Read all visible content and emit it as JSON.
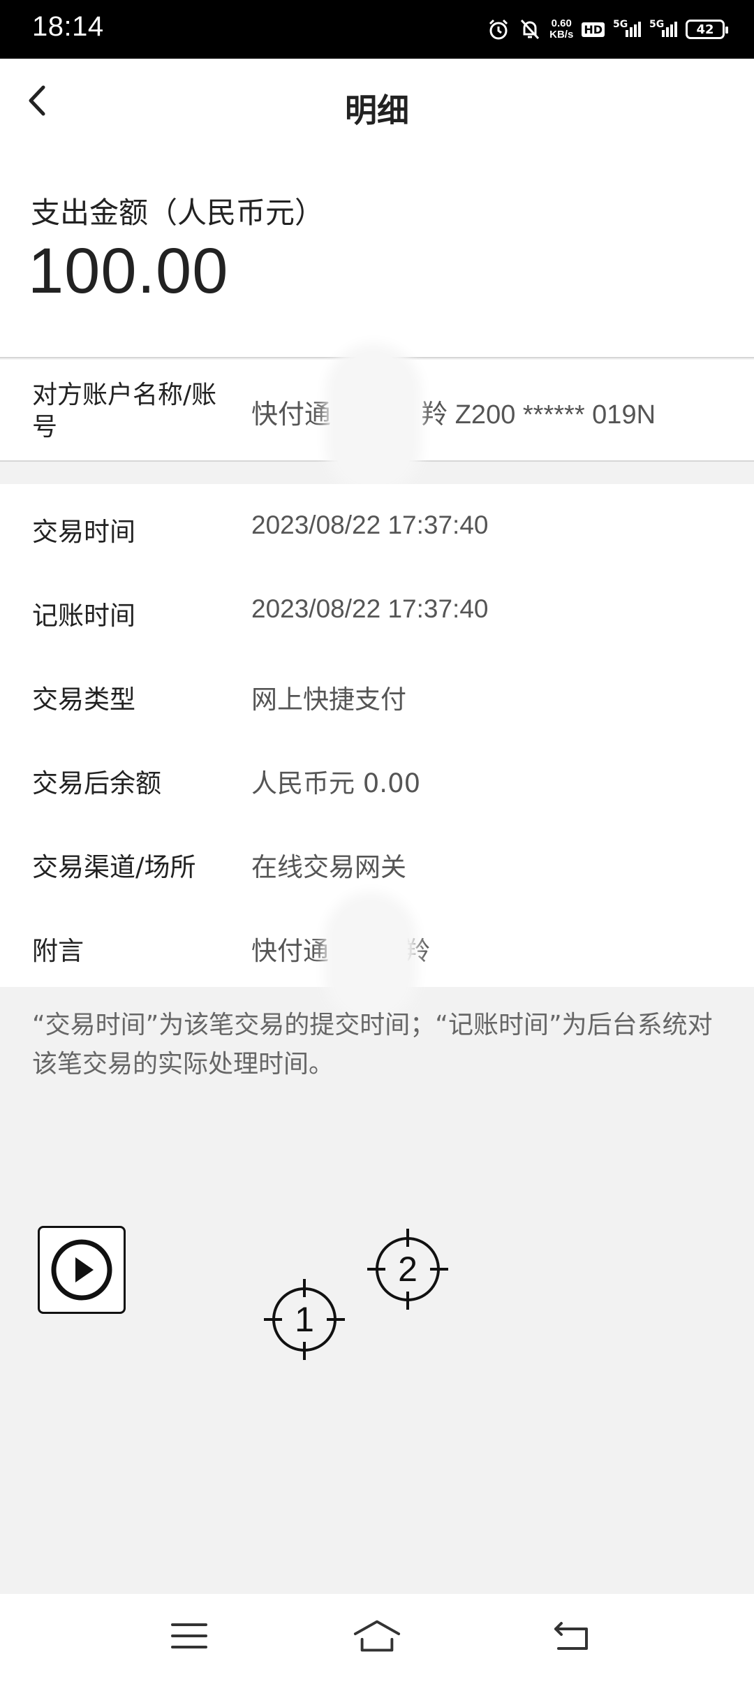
{
  "status_bar": {
    "time": "18:14",
    "net_speed_value": "0.60",
    "net_speed_unit": "KB/s",
    "hd_label": "HD",
    "sim1_label": "5G",
    "sim2_label": "5G",
    "battery": "42"
  },
  "header": {
    "title": "明细"
  },
  "amount": {
    "label": "支出金额（人民币元）",
    "value": "100.00"
  },
  "counterparty": {
    "label": "对方账户名称/账号",
    "value_prefix": "快付通",
    "value_middle": "羚",
    "value_suffix": "Z200 ****** 019N"
  },
  "details": [
    {
      "label": "交易时间",
      "value": "2023/08/22  17:37:40"
    },
    {
      "label": "记账时间",
      "value": "2023/08/22  17:37:40"
    },
    {
      "label": "交易类型",
      "value": "网上快捷支付"
    },
    {
      "label": "交易后余额",
      "value": "人民币元 0.00"
    },
    {
      "label": "交易渠道/场所",
      "value": "在线交易网关"
    },
    {
      "label": "附言",
      "value": "快付通",
      "value_tail": "羚"
    }
  ],
  "note": "“交易时间”为该笔交易的提交时间；“记账时间”为后台系统对该笔交易的实际处理时间。",
  "targets": [
    {
      "label": "1"
    },
    {
      "label": "2"
    }
  ],
  "icons": {
    "back": "chevron-left-icon",
    "play": "play-icon",
    "menu": "menu-icon",
    "home": "home-icon",
    "return": "back-icon"
  }
}
